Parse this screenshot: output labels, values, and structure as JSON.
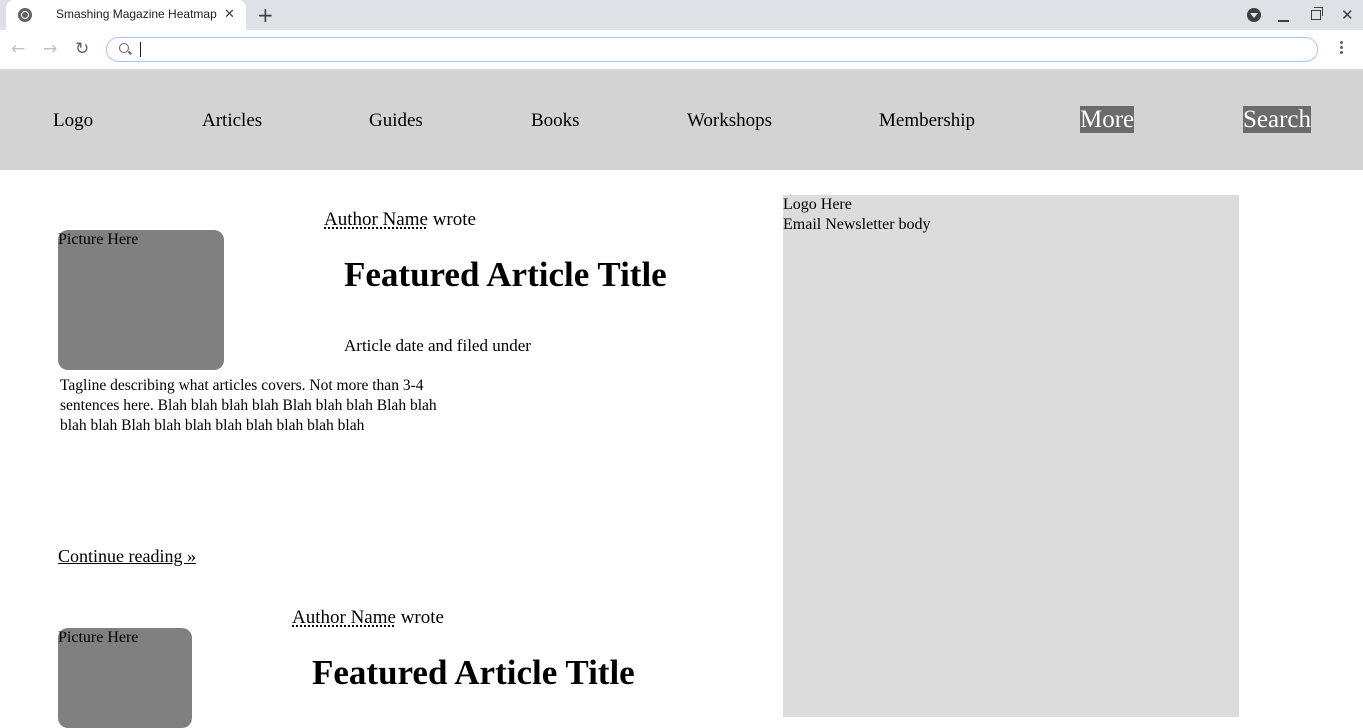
{
  "browser": {
    "tab_title": "Smashing Magazine Heatmap",
    "tab_close": "✕",
    "new_tab": "+",
    "win_close": "✕",
    "back": "←",
    "forward": "→",
    "reload": "↻",
    "address_value": ""
  },
  "nav": {
    "items": [
      "Logo",
      "Articles",
      "Guides",
      "Books",
      "Workshops",
      "Membership"
    ],
    "more": "More",
    "search": "Search",
    "highlight_color": "#6b6b6b",
    "bar_color": "#d3d3d3"
  },
  "articles": [
    {
      "author_name": "Author Name",
      "author_suffix": " wrote",
      "picture": "Picture Here",
      "title": "Featured Article Title",
      "meta": "Article date and filed under",
      "tagline": "Tagline describing what articles covers. Not more than 3-4 sentences here. Blah blah blah blah Blah blah blah Blah blah blah blah Blah blah blah blah blah blah blah blah",
      "continue": "Continue reading »"
    },
    {
      "author_name": "Author Name",
      "author_suffix": " wrote",
      "picture": "Picture Here",
      "title": "Featured Article Title"
    }
  ],
  "sidebar": {
    "logo": "Logo Here",
    "newsletter": "Email Newsletter body"
  }
}
